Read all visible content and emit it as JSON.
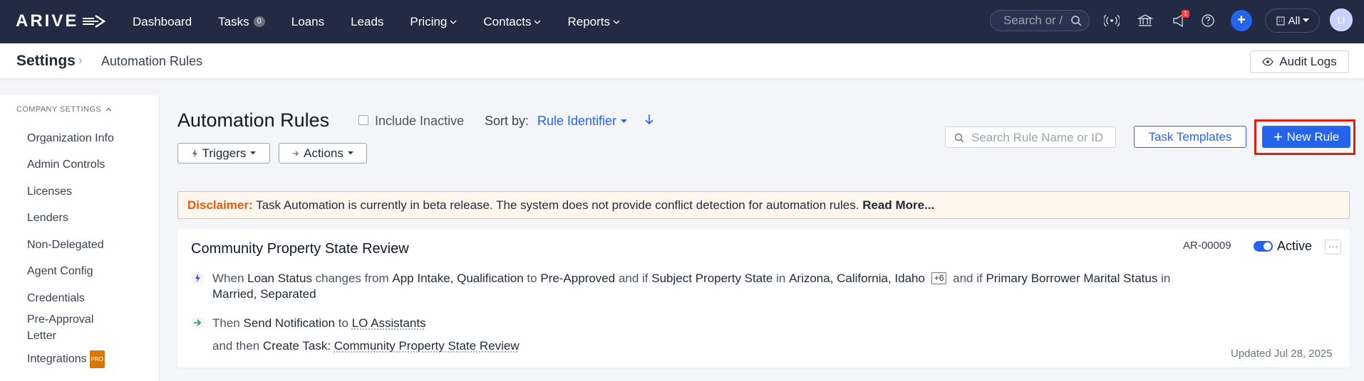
{
  "app": {
    "logo_text": "ARIVE"
  },
  "nav": {
    "items": [
      {
        "label": "Dashboard"
      },
      {
        "label": "Tasks",
        "badge": "0"
      },
      {
        "label": "Loans"
      },
      {
        "label": "Leads"
      },
      {
        "label": "Pricing",
        "dropdown": true
      },
      {
        "label": "Contacts",
        "dropdown": true
      },
      {
        "label": "Reports",
        "dropdown": true
      }
    ],
    "search_placeholder": "Search or /",
    "notification_count": "1",
    "scope_label": "All",
    "avatar_initials": "LI",
    "colors": {
      "background": "#232a43",
      "accent": "#2563eb"
    }
  },
  "breadcrumb": {
    "root": "Settings",
    "current": "Automation Rules"
  },
  "header_actions": {
    "audit_logs": "Audit Logs"
  },
  "sidebar": {
    "section": "COMPANY SETTINGS",
    "items": [
      {
        "label": "Organization Info"
      },
      {
        "label": "Admin Controls"
      },
      {
        "label": "Licenses"
      },
      {
        "label": "Lenders"
      },
      {
        "label": "Non-Delegated"
      },
      {
        "label": "Agent Config"
      },
      {
        "label": "Credentials"
      },
      {
        "label": "Pre-Approval Letter"
      },
      {
        "label": "Integrations",
        "badge": "PRO"
      }
    ]
  },
  "main": {
    "title": "Automation Rules",
    "include_inactive": "Include Inactive",
    "sort_label": "Sort by:",
    "sort_value": "Rule Identifier",
    "sort_direction_icon": "arrow-down-icon",
    "filters": {
      "triggers": "Triggers",
      "actions": "Actions"
    },
    "search_placeholder": "Search Rule Name or ID",
    "task_templates": "Task Templates",
    "new_rule": "New Rule"
  },
  "disclaimer": {
    "label": "Disclaimer:",
    "text": "Task Automation is currently in beta release. The system does not provide conflict detection for automation rules.",
    "link": "Read More..."
  },
  "rules": [
    {
      "title": "Community Property State Review",
      "id": "AR-00009",
      "status": "Active",
      "active": true,
      "trigger": {
        "when": "When",
        "field1": "Loan Status",
        "changes_from": "changes from",
        "from_values": "App Intake, Qualification",
        "to": "to",
        "to_value": "Pre-Approved",
        "and_if_1": "and if",
        "field2": "Subject Property State",
        "in_1": "in",
        "states": "Arizona, California, Idaho",
        "more": "+6",
        "and_if_2": "and if",
        "field3": "Primary Borrower Marital Status",
        "in_2": "in",
        "marital": "Married, Separated"
      },
      "action1": {
        "then": "Then",
        "action": "Send Notification",
        "to": "to",
        "target": "LO Assistants"
      },
      "action2": {
        "and_then": "and then",
        "action": "Create Task:",
        "target": "Community Property State Review"
      },
      "updated": "Updated Jul 28, 2025"
    }
  ]
}
